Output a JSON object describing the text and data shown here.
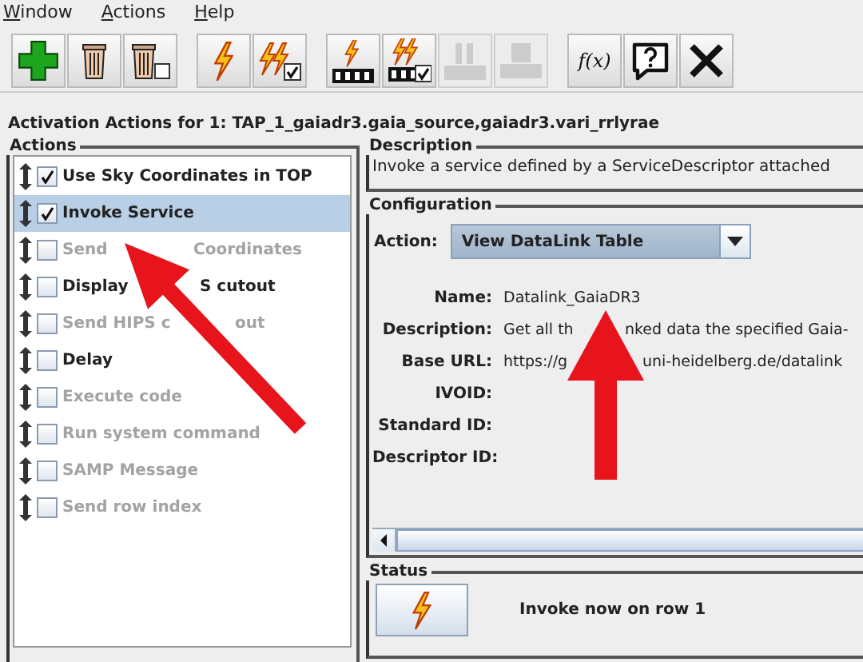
{
  "menu": [
    "Window",
    "Actions",
    "Help"
  ],
  "toolbar": [
    {
      "kind": "add",
      "disabled": false
    },
    {
      "kind": "delete",
      "disabled": false
    },
    {
      "kind": "delete-all",
      "disabled": false
    },
    {
      "kind": "invoke",
      "disabled": false
    },
    {
      "kind": "invoke-all",
      "disabled": false
    },
    {
      "kind": "invoke-film",
      "disabled": false
    },
    {
      "kind": "invoke-all-film",
      "disabled": false
    },
    {
      "kind": "pause",
      "disabled": true
    },
    {
      "kind": "stop",
      "disabled": true
    },
    {
      "kind": "function",
      "text": "f(x)",
      "disabled": false
    },
    {
      "kind": "help",
      "disabled": false
    },
    {
      "kind": "close",
      "disabled": false
    }
  ],
  "title": "Activation Actions for 1: TAP_1_gaiadr3.gaia_source,gaiadr3.vari_rrlyrae",
  "actions": {
    "title": "Actions",
    "items": [
      {
        "label_parts": [
          "Use Sky Coordinates in TOP"
        ],
        "checked": true,
        "enabled": true,
        "selected": false
      },
      {
        "label_parts": [
          "Invoke Service"
        ],
        "checked": true,
        "enabled": true,
        "selected": true
      },
      {
        "label_parts": [
          "Send",
          "Coordinates"
        ],
        "checked": false,
        "enabled": false,
        "selected": false
      },
      {
        "label_parts": [
          "Display",
          "S cutout"
        ],
        "checked": false,
        "enabled": true,
        "selected": false
      },
      {
        "label_parts": [
          "Send HIPS c",
          "out"
        ],
        "checked": false,
        "enabled": false,
        "selected": false
      },
      {
        "label_parts": [
          "Delay"
        ],
        "checked": false,
        "enabled": true,
        "selected": false
      },
      {
        "label_parts": [
          "Execute code"
        ],
        "checked": false,
        "enabled": false,
        "selected": false
      },
      {
        "label_parts": [
          "Run system command"
        ],
        "checked": false,
        "enabled": false,
        "selected": false
      },
      {
        "label_parts": [
          "SAMP Message"
        ],
        "checked": false,
        "enabled": false,
        "selected": false
      },
      {
        "label_parts": [
          "Send row index"
        ],
        "checked": false,
        "enabled": false,
        "selected": false
      }
    ]
  },
  "description": {
    "title": "Description",
    "text": "Invoke a service defined by a ServiceDescriptor attached"
  },
  "configuration": {
    "title": "Configuration",
    "action_label": "Action:",
    "action_value": "View DataLink Table",
    "fields": [
      {
        "label": "Name:",
        "value_parts": [
          "Datalink_GaiaDR3"
        ]
      },
      {
        "label": "Description:",
        "value_parts": [
          "Get all th",
          "nked data the specified Gaia-"
        ]
      },
      {
        "label": "Base URL:",
        "value_parts": [
          "https://g",
          "uni-heidelberg.de/datalink"
        ]
      },
      {
        "label": "IVOID:"
      },
      {
        "label": "Standard ID:"
      },
      {
        "label": "Descriptor ID:"
      }
    ]
  },
  "status": {
    "title": "Status",
    "text": "Invoke now on row 1"
  }
}
